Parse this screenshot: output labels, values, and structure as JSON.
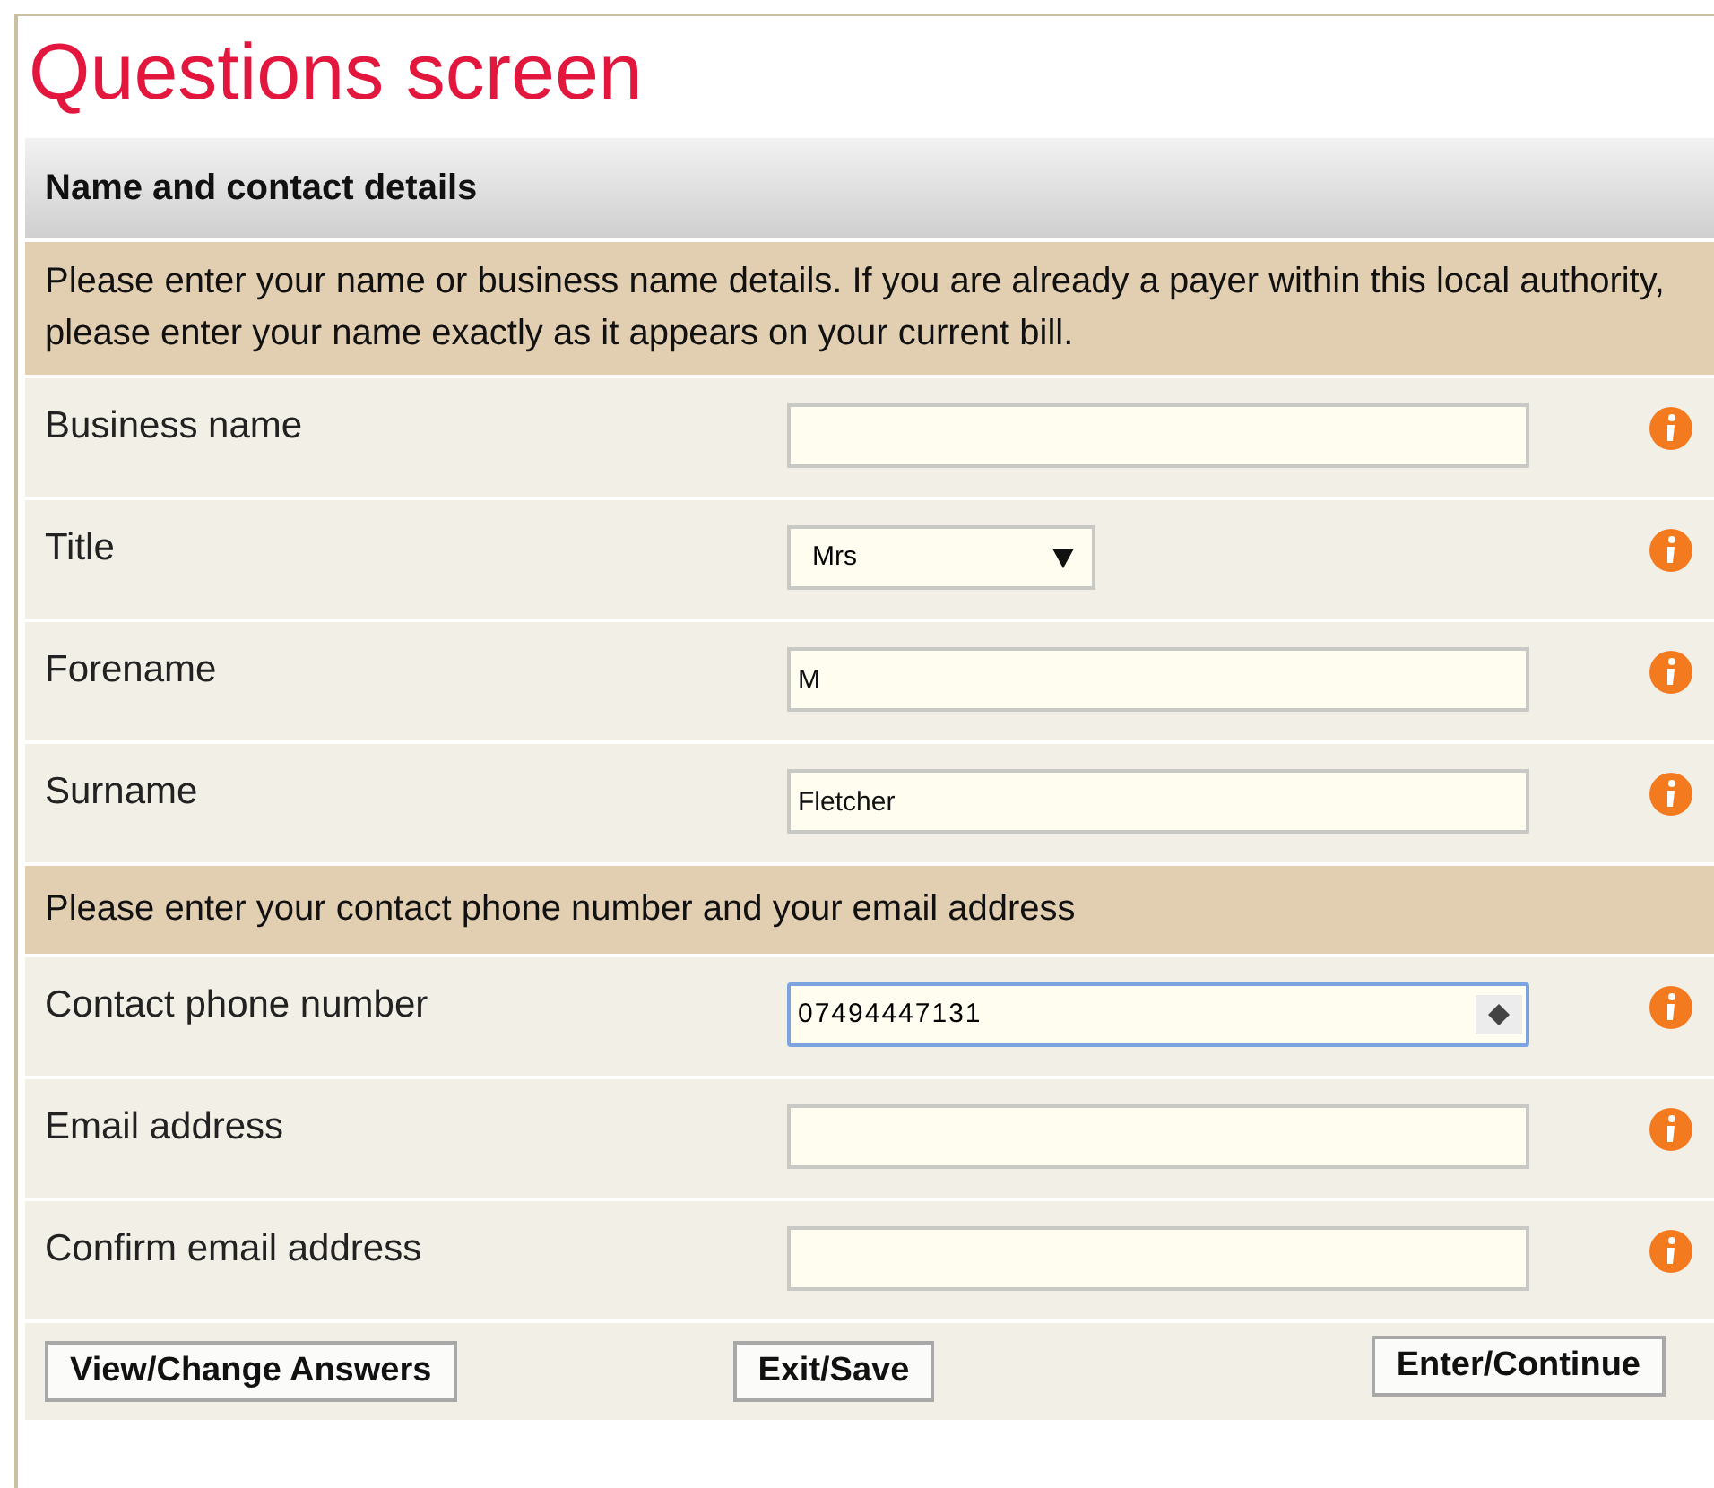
{
  "page_title": "Questions screen",
  "section": {
    "title": "Name and contact details"
  },
  "items": [
    {
      "kind": "note",
      "text": "Please enter your name or business name details. If you are already a payer within this local authority, please enter your name exactly as it appears on your current bill."
    },
    {
      "kind": "text",
      "label": "Business name",
      "focused": false
    },
    {
      "kind": "select",
      "label": "Title",
      "value": "Mrs",
      "focused": false
    },
    {
      "kind": "text",
      "label": "Forename",
      "value": "M",
      "focused": false
    },
    {
      "kind": "text",
      "label": "Surname",
      "value": "Fletcher",
      "focused": false
    },
    {
      "kind": "note",
      "text": "Please enter your contact phone number and your email address"
    },
    {
      "kind": "number",
      "label": "Contact phone number",
      "value": "07494447131",
      "focused": true
    },
    {
      "kind": "text",
      "label": "Email address",
      "focused": false
    },
    {
      "kind": "text",
      "label": "Confirm email address",
      "focused": false
    }
  ],
  "buttons": [
    "View/Change Answers",
    "Exit/Save",
    "Enter/Continue"
  ]
}
